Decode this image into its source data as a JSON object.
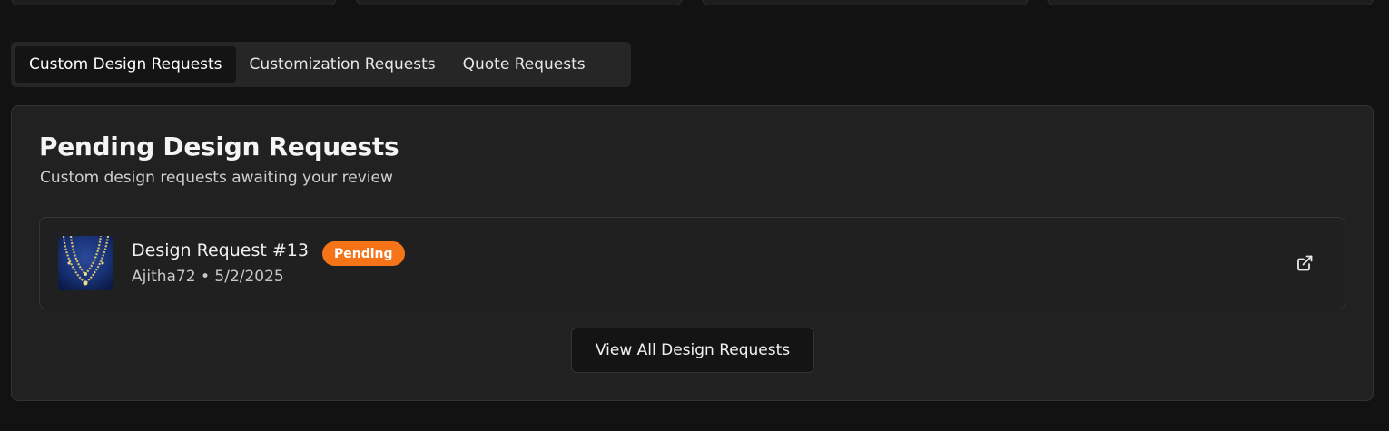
{
  "tabs": [
    {
      "label": "Custom Design Requests",
      "active": true
    },
    {
      "label": "Customization Requests",
      "active": false
    },
    {
      "label": "Quote Requests",
      "active": false
    }
  ],
  "panel": {
    "title": "Pending Design Requests",
    "subtitle": "Custom design requests awaiting your review"
  },
  "requests": [
    {
      "title": "Design Request #13",
      "status": "Pending",
      "meta": "Ajitha72 • 5/2/2025",
      "thumbnail_icon": "necklace-thumbnail",
      "link_icon": "external-link-icon"
    }
  ],
  "actions": {
    "view_all_label": "View All Design Requests"
  },
  "colors": {
    "background": "#121212",
    "panel": "#212121",
    "badge_pending": "#f57418",
    "active_tab": "#141414"
  }
}
